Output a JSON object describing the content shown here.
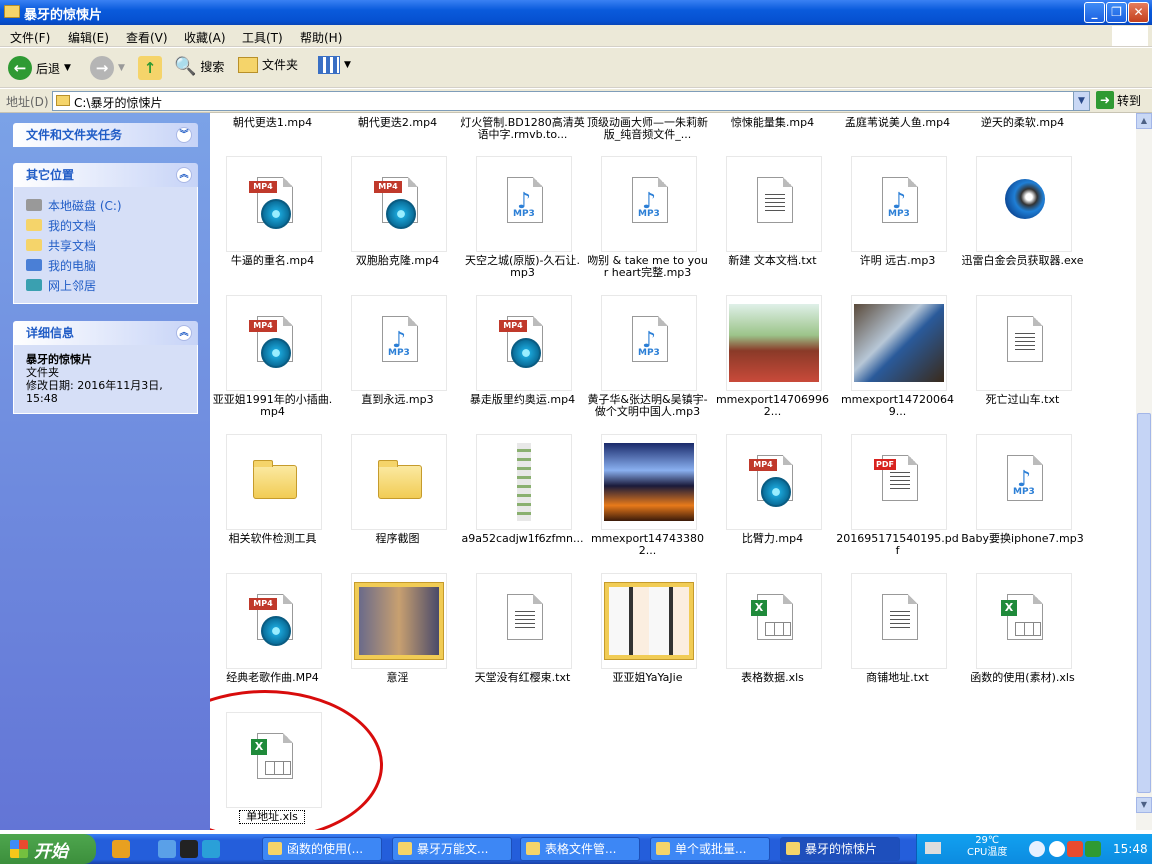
{
  "window": {
    "title": "暴牙的惊悚片"
  },
  "menu": [
    "文件(F)",
    "编辑(E)",
    "查看(V)",
    "收藏(A)",
    "工具(T)",
    "帮助(H)"
  ],
  "toolbar": {
    "back": "后退",
    "search": "搜索",
    "folders": "文件夹"
  },
  "address": {
    "label": "地址(D)",
    "value": "C:\\暴牙的惊悚片",
    "go": "转到"
  },
  "sidebar": {
    "tasks_title": "文件和文件夹任务",
    "other_title": "其它位置",
    "other_items": [
      "本地磁盘 (C:)",
      "我的文档",
      "共享文档",
      "我的电脑",
      "网上邻居"
    ],
    "details_title": "详细信息",
    "details_name": "暴牙的惊悚片",
    "details_type": "文件夹",
    "details_modified": "修改日期: 2016年11月3日, 15:48"
  },
  "top_row": [
    "朝代更迭1.mp4",
    "朝代更迭2.mp4",
    "灯火管制.BD1280高清英语中字.rmvb.to...",
    "顶级动画大师—一朱莉新版_纯音频文件_...",
    "惊悚能量集.mp4",
    "孟庭苇说美人鱼.mp4",
    "逆天的柔软.mp4"
  ],
  "files": [
    {
      "name": "牛逼的重名.mp4",
      "kind": "mp4"
    },
    {
      "name": "双胞胎克隆.mp4",
      "kind": "mp4"
    },
    {
      "name": "天空之城(原版)-久石让.mp3",
      "kind": "mp3"
    },
    {
      "name": "吻别 & take me to your heart完整.mp3",
      "kind": "mp3"
    },
    {
      "name": "新建 文本文档.txt",
      "kind": "txt"
    },
    {
      "name": "许明 远古.mp3",
      "kind": "mp3"
    },
    {
      "name": "迅雷白金会员获取器.exe",
      "kind": "exe"
    },
    {
      "name": "亚亚姐1991年的小插曲.mp4",
      "kind": "mp4"
    },
    {
      "name": "直到永远.mp3",
      "kind": "mp3"
    },
    {
      "name": "暴走版里约奥运.mp4",
      "kind": "mp4"
    },
    {
      "name": "黄子华&张达明&吴镇宇-做个文明中国人.mp3",
      "kind": "mp3"
    },
    {
      "name": "mmexport147069962...",
      "kind": "photo1"
    },
    {
      "name": "mmexport147200649...",
      "kind": "photo2"
    },
    {
      "name": "死亡过山车.txt",
      "kind": "txt"
    },
    {
      "name": "相关软件检测工具",
      "kind": "folder"
    },
    {
      "name": "程序截图",
      "kind": "folder"
    },
    {
      "name": "a9a52cadjw1f6zfmn...",
      "kind": "photo3"
    },
    {
      "name": "mmexport147433802...",
      "kind": "photo4"
    },
    {
      "name": "比臂力.mp4",
      "kind": "mp4"
    },
    {
      "name": "201695171540195.pdf",
      "kind": "pdf"
    },
    {
      "name": "Baby要换iphone7.mp3",
      "kind": "mp3"
    },
    {
      "name": "经典老歌作曲.MP4",
      "kind": "mp4"
    },
    {
      "name": "意淫",
      "kind": "thumbfolder1"
    },
    {
      "name": "天堂没有红樱束.txt",
      "kind": "txt"
    },
    {
      "name": "亚亚姐YaYaJie",
      "kind": "thumbfolder2"
    },
    {
      "name": "表格数据.xls",
      "kind": "xls"
    },
    {
      "name": "商铺地址.txt",
      "kind": "txt"
    },
    {
      "name": "函数的使用(素材).xls",
      "kind": "xls"
    },
    {
      "name": "单地址.xls",
      "kind": "xls"
    }
  ],
  "icon_text": {
    "mp4": "MP4",
    "mp3": "MP3",
    "pdf": "PDF",
    "xls": "X"
  },
  "taskbar": {
    "start": "开始",
    "tasks": [
      "函数的使用(...",
      "暴牙万能文...",
      "表格文件管...",
      "单个或批量...",
      "暴牙的惊悚片"
    ],
    "temp": "29℃",
    "temp_label": "CPU温度",
    "time": "15:48"
  },
  "colors": {
    "title_blue": "#0a5bdc",
    "sidebar_blue": "#6f8ee0",
    "annotation_red": "#d80c0c"
  }
}
